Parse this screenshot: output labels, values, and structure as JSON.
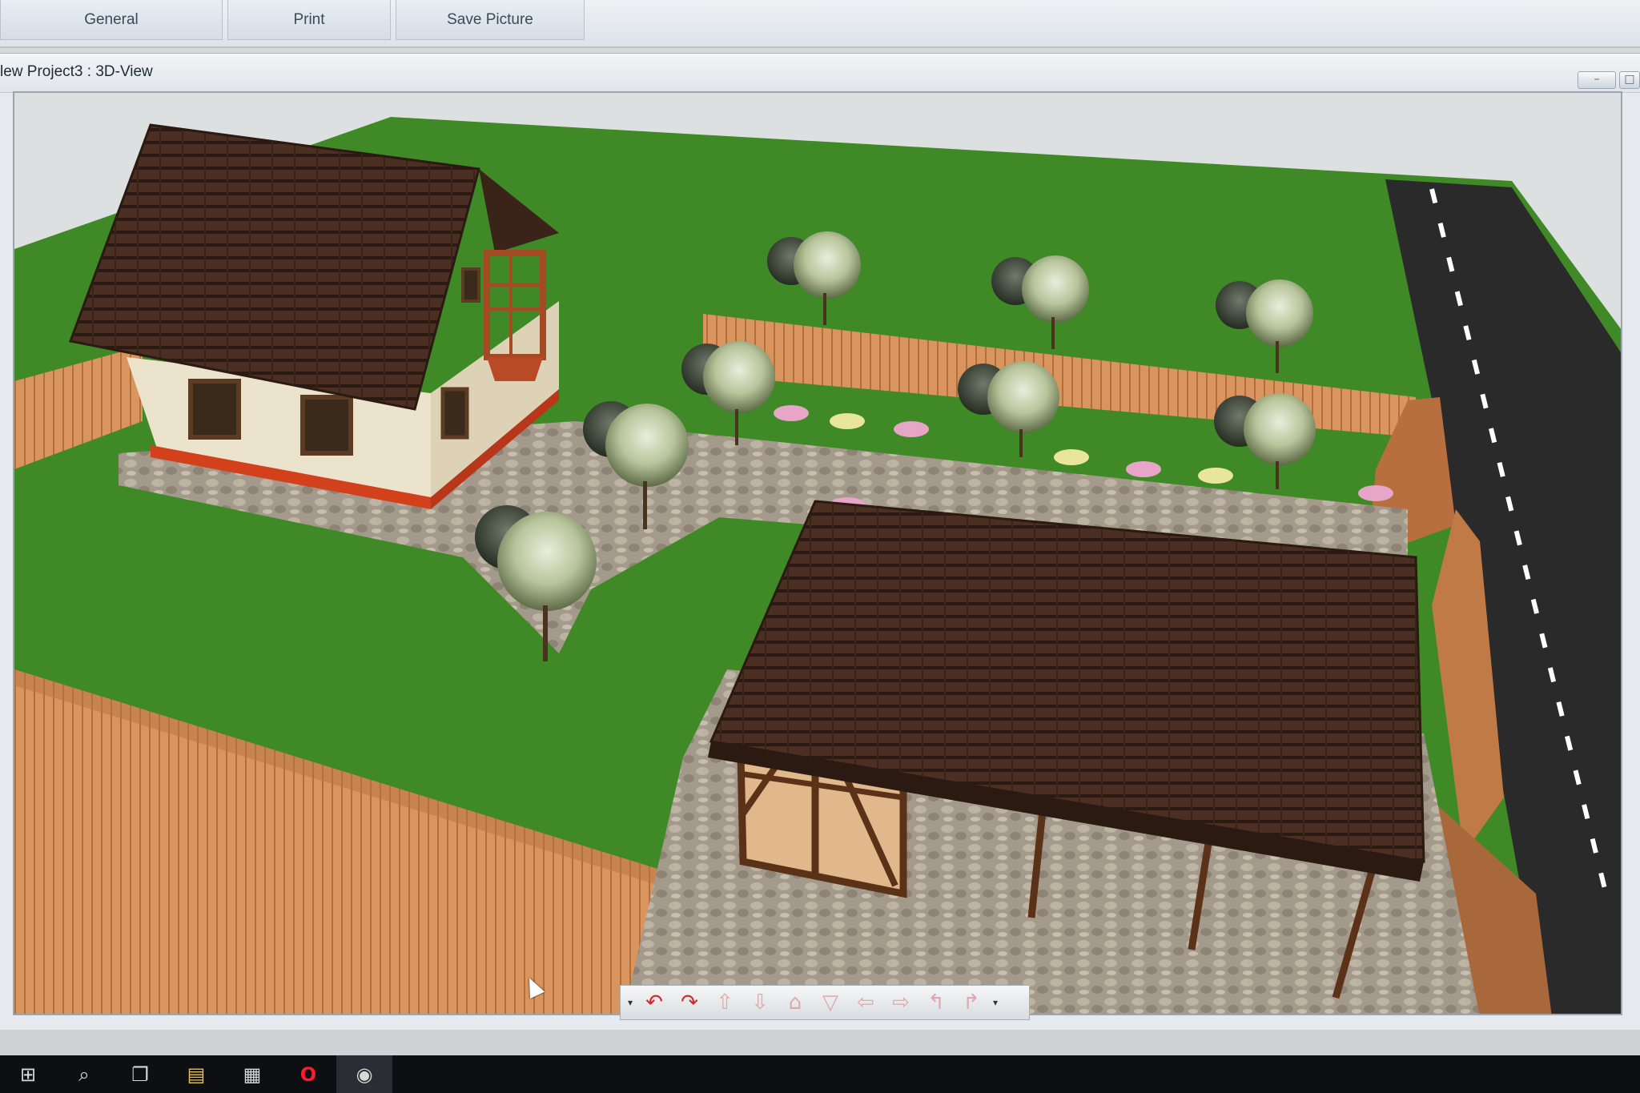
{
  "toolbar": {
    "general_label": "General",
    "print_label": "Print",
    "save_picture_label": "Save Picture"
  },
  "window": {
    "title": "lew Project3 : 3D-View",
    "minimize_glyph": "–",
    "restore_glyph": "□"
  },
  "colors": {
    "grass": "#3f8a26",
    "road": "#2a2a2a",
    "fence": "#d9955d",
    "roof": "#4a2f22",
    "wall": "#ece3cc",
    "path": "#a49a8c"
  },
  "nav_toolbar": {
    "buttons": [
      {
        "name": "dropdown-left",
        "glyph": "▾"
      },
      {
        "name": "rotate-left-icon",
        "glyph": "↶"
      },
      {
        "name": "rotate-right-icon",
        "glyph": "↷"
      },
      {
        "name": "move-up-icon",
        "glyph": "⇧"
      },
      {
        "name": "move-down-icon",
        "glyph": "⇩"
      },
      {
        "name": "tilt-up-icon",
        "glyph": "⌂"
      },
      {
        "name": "tilt-down-icon",
        "glyph": "▽"
      },
      {
        "name": "move-left-icon",
        "glyph": "⇦"
      },
      {
        "name": "move-right-icon",
        "glyph": "⇨"
      },
      {
        "name": "turn-left-icon",
        "glyph": "↰"
      },
      {
        "name": "turn-right-icon",
        "glyph": "↱"
      },
      {
        "name": "dropdown-right",
        "glyph": "▾"
      }
    ]
  },
  "taskbar": {
    "items": [
      {
        "name": "start-icon",
        "glyph": "⊞"
      },
      {
        "name": "search-icon",
        "glyph": "⌕"
      },
      {
        "name": "task-view-icon",
        "glyph": "❐"
      },
      {
        "name": "file-explorer-icon",
        "glyph": "▤"
      },
      {
        "name": "store-icon",
        "glyph": "▦"
      },
      {
        "name": "opera-icon",
        "glyph": "O"
      },
      {
        "name": "app-icon",
        "glyph": "◉"
      }
    ]
  }
}
